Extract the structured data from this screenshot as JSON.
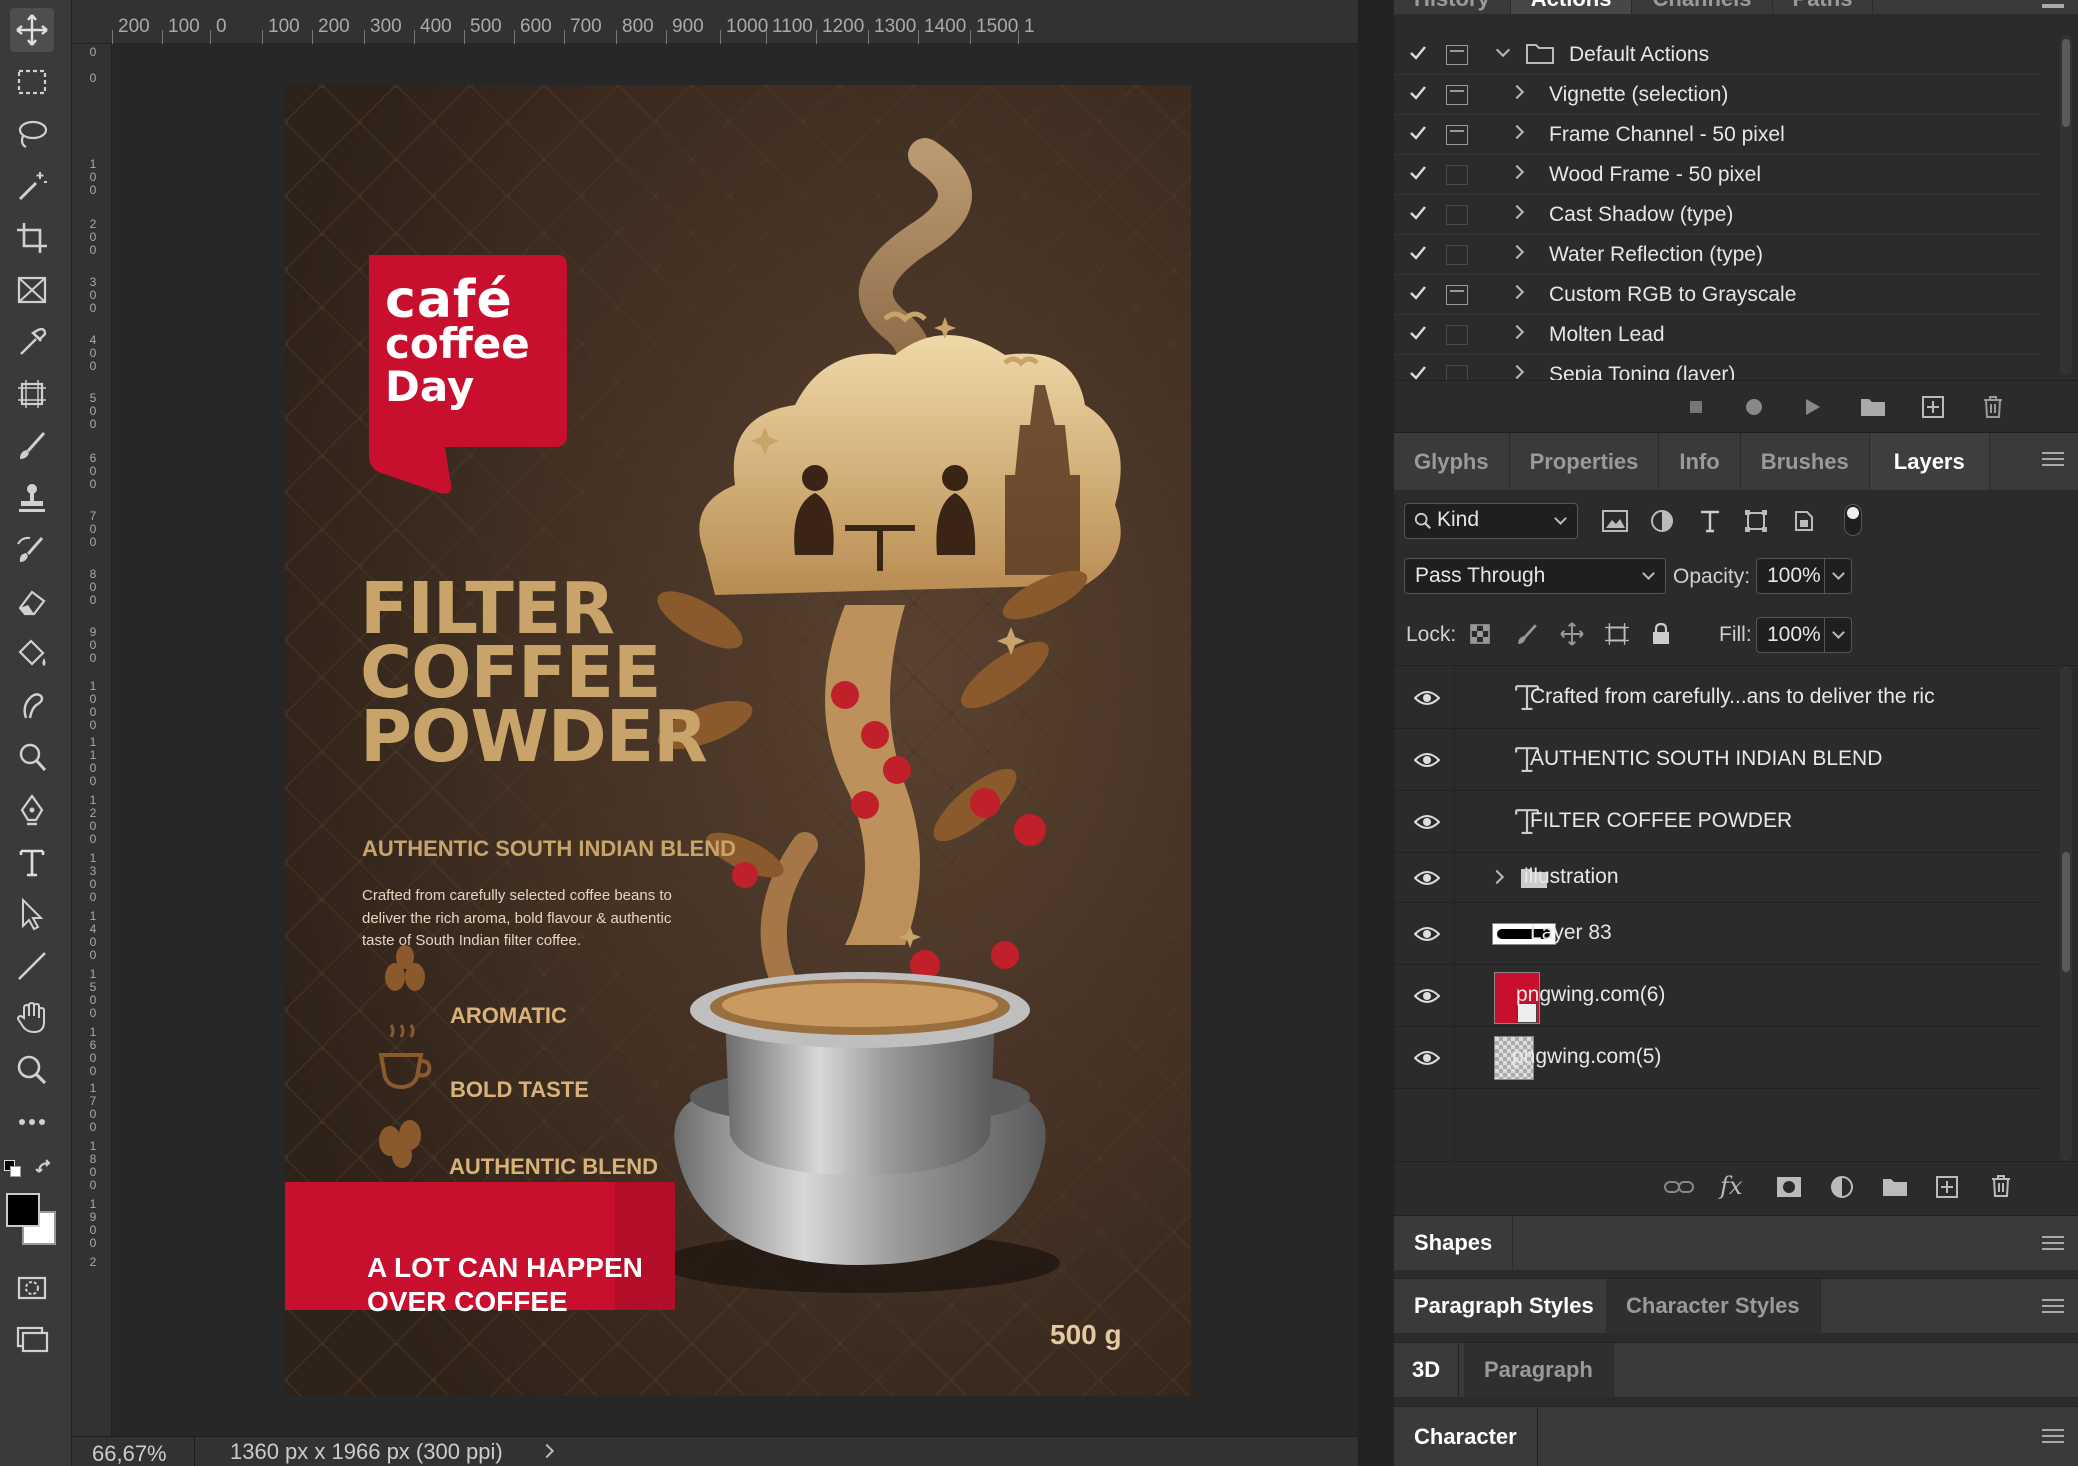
{
  "ruler": {
    "top_labels": [
      "200",
      "100",
      "0",
      "100",
      "200",
      "300",
      "400",
      "500",
      "600",
      "700",
      "800",
      "900",
      "1000",
      "1100",
      "1200",
      "1300",
      "1400",
      "1500",
      "1"
    ],
    "left_labels": [
      "0",
      "0",
      "100",
      "200",
      "300",
      "400",
      "500",
      "600",
      "700",
      "800",
      "900",
      "1000",
      "1100",
      "1200",
      "1300",
      "1400",
      "1500",
      "1600",
      "1700",
      "1800",
      "1900",
      "2"
    ]
  },
  "status": {
    "zoom": "66,67%",
    "doc_info": "1360 px x 1966 px (300 ppi)"
  },
  "artwork": {
    "brand_line1": "café",
    "brand_line2": "coffee",
    "brand_line3": "Day",
    "title_line1": "FILTER",
    "title_line2": "COFFEE",
    "title_line3": "POWDER",
    "subtitle": "AUTHENTIC SOUTH INDIAN BLEND",
    "description_line1": "Crafted from carefully selected coffee beans to",
    "description_line2": "deliver the rich aroma, bold flavour & authentic",
    "description_line3": "taste of South Indian filter coffee.",
    "features": [
      "AROMATIC",
      "BOLD TASTE",
      "AUTHENTIC BLEND"
    ],
    "banner_line1": "A LOT CAN HAPPEN",
    "banner_line2": "OVER COFFEE",
    "weight": "500 g"
  },
  "top_panel": {
    "tabs": [
      "History",
      "Actions",
      "Channels",
      "Paths"
    ],
    "active_tab": "Actions",
    "set_name": "Default Actions",
    "actions": [
      {
        "label": "Vignette (selection)",
        "dialog": true
      },
      {
        "label": "Frame Channel - 50 pixel",
        "dialog": true
      },
      {
        "label": "Wood Frame - 50 pixel",
        "dialog": false
      },
      {
        "label": "Cast Shadow (type)",
        "dialog": false
      },
      {
        "label": "Water Reflection (type)",
        "dialog": false
      },
      {
        "label": "Custom RGB to Grayscale",
        "dialog": true
      },
      {
        "label": "Molten Lead",
        "dialog": false
      },
      {
        "label": "Sepia Toning (layer)",
        "dialog": false
      }
    ]
  },
  "layers_panel": {
    "tabs": [
      "Glyphs",
      "Properties",
      "Info",
      "Brushes",
      "Layers"
    ],
    "active_tab": "Layers",
    "filter_kind": "Kind",
    "blend_mode": "Pass Through",
    "opacity_label": "Opacity:",
    "opacity": "100%",
    "lock_label": "Lock:",
    "fill_label": "Fill:",
    "fill": "100%",
    "layers": [
      {
        "name": "Crafted from carefully...ans to deliver the ric",
        "type": "text"
      },
      {
        "name": "AUTHENTIC SOUTH INDIAN BLEND",
        "type": "text"
      },
      {
        "name": "FILTER COFFEE POWDER",
        "type": "text"
      },
      {
        "name": "illustration",
        "type": "group"
      },
      {
        "name": "Layer 83",
        "type": "pixel"
      },
      {
        "name": "pngwing.com(6)",
        "type": "smart"
      },
      {
        "name": "pngwing.com(5)",
        "type": "pixel"
      }
    ]
  },
  "collapsed_panels": {
    "shapes": "Shapes",
    "paragraph_styles": "Paragraph Styles",
    "character_styles": "Character Styles",
    "three_d": "3D",
    "paragraph": "Paragraph",
    "character": "Character"
  },
  "colors": {
    "accent_red": "#c8102e",
    "gold": "#c9a46a",
    "panel_bg": "#2b2b2b",
    "poster_bg": "#3b2b1f"
  }
}
